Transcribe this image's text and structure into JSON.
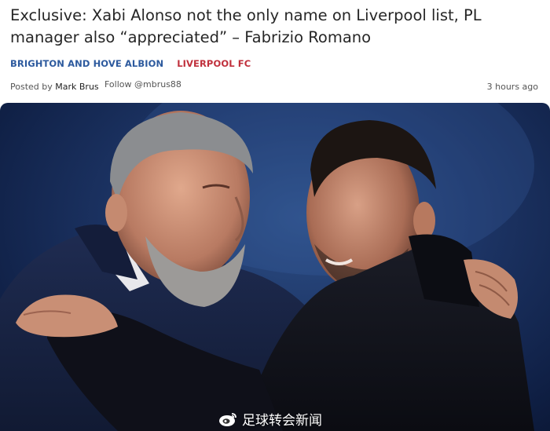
{
  "article": {
    "headline": "Exclusive: Xabi Alonso not the only name on Liverpool list, PL manager also “appreciated” – Fabrizio Romano",
    "tags": [
      "BRIGHTON AND HOVE ALBION",
      "LIVERPOOL FC"
    ],
    "byline": {
      "posted_by": "Posted by",
      "author": "Mark Brus",
      "follow": "Follow @mbrus88",
      "time": "3 hours ago"
    }
  },
  "photo": {
    "watermark_text": "足球转会新闻",
    "watermark_icon": "weibo-icon"
  },
  "colors": {
    "tag_brighton": "#2d5a9e",
    "tag_liverpool": "#c0303c",
    "photo_background": "#1d3566"
  }
}
